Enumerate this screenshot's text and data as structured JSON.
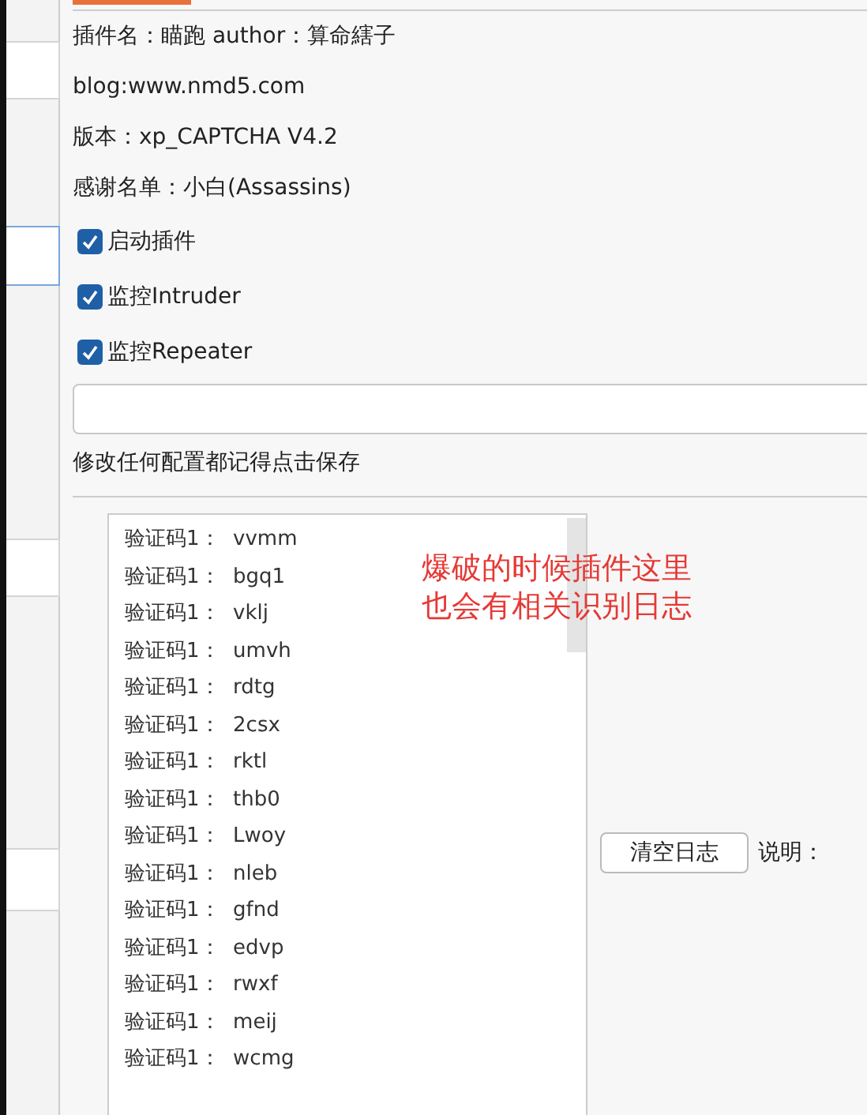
{
  "info_lines": [
    "插件名：瞄跑 author：算命縖子",
    "blog:www.nmd5.com",
    "版本：xp_CAPTCHA V4.2",
    "感谢名单：小白(Assassins)"
  ],
  "options": [
    {
      "label": "启动插件",
      "checked": true
    },
    {
      "label": "监控Intruder",
      "checked": true
    },
    {
      "label": "监控Repeater",
      "checked": true
    }
  ],
  "save_hint": "修改任何配置都记得点击保存",
  "log_entries": [
    "验证码1：  vvmm",
    "验证码1：  bgq1",
    "验证码1：  vklj",
    "验证码1：  umvh",
    "验证码1：  rdtg",
    "验证码1：  2csx",
    "验证码1：  rktl",
    "验证码1：  thb0",
    "验证码1：  Lwoy",
    "验证码1：  nleb",
    "验证码1：  gfnd",
    "验证码1：  edvp",
    "验证码1：  rwxf",
    "验证码1：  meij",
    "验证码1：  wcmg"
  ],
  "annotation": [
    "爆破的时候插件这里",
    "也会有相关识别日志"
  ],
  "clear_button": "清空日志",
  "note_label": "说明："
}
